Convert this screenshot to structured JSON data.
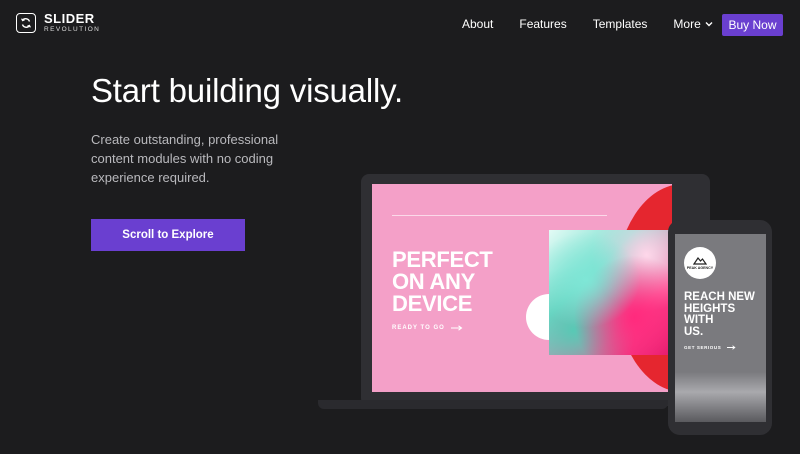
{
  "brand": {
    "title": "SLIDER",
    "subtitle": "REVOLUTION"
  },
  "nav": {
    "items": [
      "About",
      "Features",
      "Templates"
    ],
    "more_label": "More",
    "buy_label": "Buy Now"
  },
  "hero": {
    "title": "Start building visually.",
    "description": "Create outstanding, professional content modules with no coding experience required.",
    "cta_label": "Scroll to Explore"
  },
  "laptop_slide": {
    "headline": "PERFECT\nON ANY\nDEVICE",
    "cta": "READY TO GO"
  },
  "phone_slide": {
    "badge": "PEAK AGENCY",
    "headline": "REACH NEW\nHEIGHTS\nWITH\nUS.",
    "cta": "GET SERIOUS"
  },
  "colors": {
    "background": "#1c1c1e",
    "accent": "#6a3fd0",
    "slide_pink": "#f4a0c8",
    "slide_red": "#e5262f"
  }
}
